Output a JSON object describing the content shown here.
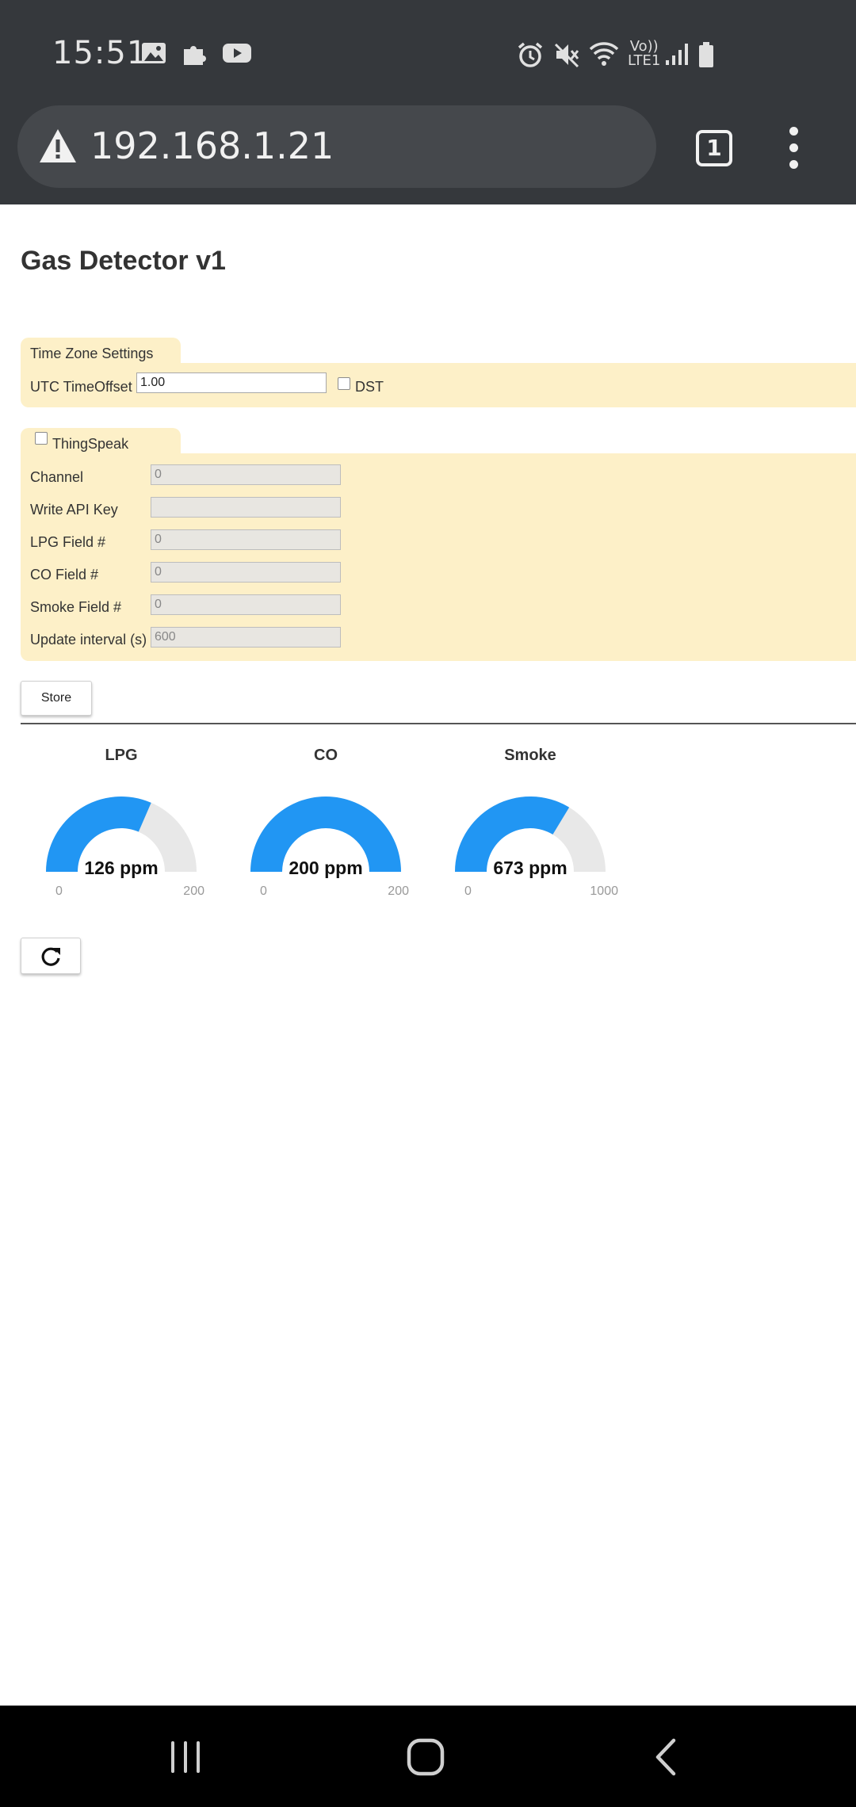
{
  "status_bar": {
    "time": "15:51",
    "left_icons": [
      "image-icon",
      "puzzle-icon",
      "youtube-icon"
    ],
    "right_icons": [
      "alarm-icon",
      "mute-icon",
      "wifi-icon",
      "volte-icon",
      "signal-icon",
      "battery-icon"
    ],
    "volte_top": "Vo))",
    "volte_bottom": "LTE1"
  },
  "browser": {
    "url": "192.168.1.21",
    "tab_count": "1",
    "warning_icon": "warning-icon",
    "menu_icon": "more-vert-icon"
  },
  "page": {
    "title": "Gas Detector v1",
    "timezone": {
      "legend": "Time Zone Settings",
      "offset_label": "UTC TimeOffset",
      "offset_value": "1.00",
      "dst_label": "DST",
      "dst_checked": false
    },
    "thingspeak": {
      "legend": "ThingSpeak",
      "enabled": false,
      "fields": [
        {
          "label": "Channel",
          "value": "0"
        },
        {
          "label": "Write API Key",
          "value": ""
        },
        {
          "label": "LPG Field #",
          "value": "0"
        },
        {
          "label": "CO Field #",
          "value": "0"
        },
        {
          "label": "Smoke Field #",
          "value": "0"
        },
        {
          "label": "Update interval (s)",
          "value": "600"
        }
      ]
    },
    "store_label": "Store",
    "gauges": [
      {
        "title": "LPG",
        "value": 126,
        "display": "126 ppm",
        "min": "0",
        "max": "200",
        "max_value": 200
      },
      {
        "title": "CO",
        "value": 200,
        "display": "200 ppm",
        "min": "0",
        "max": "200",
        "max_value": 200
      },
      {
        "title": "Smoke",
        "value": 673,
        "display": "673 ppm",
        "min": "0",
        "max": "1000",
        "max_value": 1000
      }
    ],
    "refresh_icon": "refresh-icon",
    "colors": {
      "gauge_fill": "#2196f3",
      "gauge_track": "#e8e8e8",
      "fieldset_bg": "#fdf0c8"
    }
  },
  "nav_bar": {
    "icons": [
      "recents-icon",
      "home-icon",
      "back-icon"
    ]
  }
}
